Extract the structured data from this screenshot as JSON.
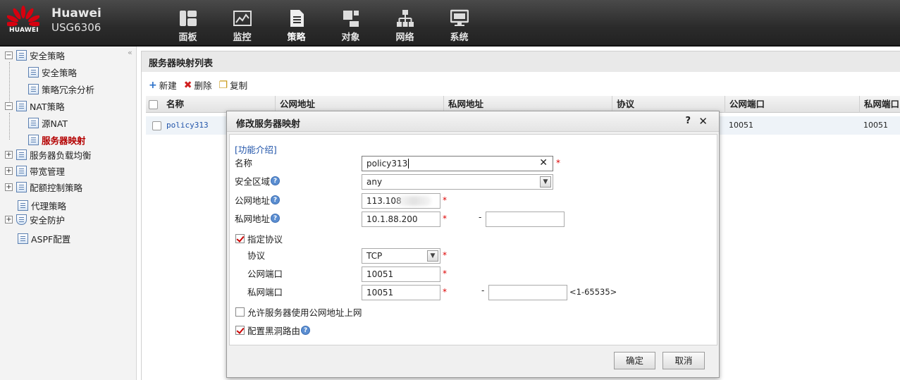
{
  "header": {
    "logo_text": "HUAWEI",
    "brand": "Huawei",
    "model": "USG6306",
    "nav": [
      {
        "label": "面板",
        "icon": "dashboard-icon"
      },
      {
        "label": "监控",
        "icon": "monitor-icon"
      },
      {
        "label": "策略",
        "icon": "policy-icon"
      },
      {
        "label": "对象",
        "icon": "object-icon"
      },
      {
        "label": "网络",
        "icon": "network-icon"
      },
      {
        "label": "系统",
        "icon": "system-icon"
      }
    ],
    "active_nav": "策略"
  },
  "sidebar": {
    "collapse_glyph": "«",
    "items": [
      {
        "label": "安全策略",
        "expander": "−"
      },
      {
        "label": "安全策略"
      },
      {
        "label": "策略冗余分析"
      },
      {
        "label": "NAT策略",
        "expander": "−"
      },
      {
        "label": "源NAT"
      },
      {
        "label": "服务器映射",
        "active": true
      },
      {
        "label": "服务器负载均衡",
        "expander": "+"
      },
      {
        "label": "带宽管理",
        "expander": "+"
      },
      {
        "label": "配额控制策略",
        "expander": "+"
      },
      {
        "label": "代理策略"
      },
      {
        "label": "安全防护",
        "expander": "+"
      },
      {
        "label": "ASPF配置"
      }
    ]
  },
  "main": {
    "title": "服务器映射列表",
    "toolbar": {
      "new": "新建",
      "delete": "删除",
      "copy": "复制"
    },
    "columns": [
      "名称",
      "公网地址",
      "私网地址",
      "协议",
      "公网端口",
      "私网端口"
    ],
    "rows": [
      {
        "name": "policy313",
        "public_port": "10051",
        "private_port": "10051"
      }
    ]
  },
  "dialog": {
    "title": "修改服务器映射",
    "help": "?",
    "close": "✕",
    "intro_link": "[功能介绍]",
    "fields": {
      "name_label": "名称",
      "name_value": "policy313",
      "zone_label": "安全区域",
      "zone_value": "any",
      "public_ip_label": "公网地址",
      "public_ip_value": "113.108",
      "private_ip_label": "私网地址",
      "private_ip_value": "10.1.88.200",
      "private_ip_end": "",
      "specify_protocol_label": "指定协议",
      "specify_protocol_checked": true,
      "protocol_label": "协议",
      "protocol_value": "TCP",
      "public_port_label": "公网端口",
      "public_port_value": "10051",
      "private_port_label": "私网端口",
      "private_port_value": "10051",
      "private_port_end": "",
      "port_range_hint": "<1-65535>",
      "allow_internet_label": "允许服务器使用公网地址上网",
      "allow_internet_checked": false,
      "blackhole_label": "配置黑洞路由",
      "blackhole_checked": true
    },
    "required_mark": "*",
    "range_dash": "-",
    "ok_label": "确定",
    "cancel_label": "取消"
  },
  "colors": {
    "header_bg": "#2b2b2b",
    "active_tree": "#b40000",
    "required": "#dd0000",
    "help_icon": "#5b8ed1"
  }
}
